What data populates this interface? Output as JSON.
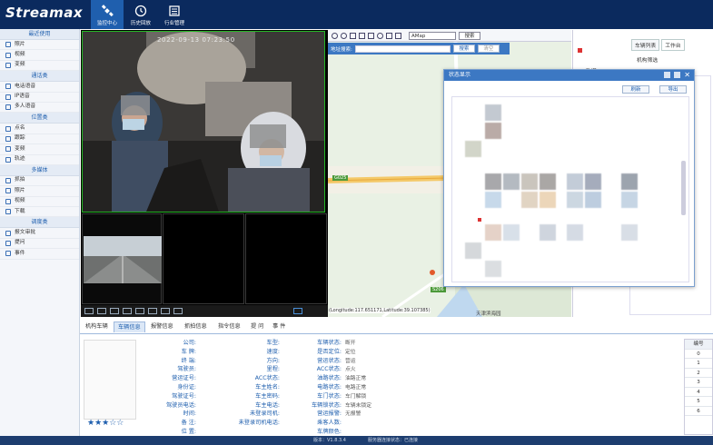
{
  "brand": {
    "logo_text": "Streamax"
  },
  "nav": [
    {
      "label": "监控中心",
      "icon": "satellite-icon",
      "active": true
    },
    {
      "label": "历史回放",
      "icon": "history-icon",
      "active": false
    },
    {
      "label": "行业管理",
      "icon": "management-icon",
      "active": false
    }
  ],
  "sidebar": {
    "sections": [
      {
        "title": "最近使用",
        "items": [
          "照片",
          "视频",
          "变频"
        ]
      },
      {
        "title": "通话类",
        "items": [
          "电话语音",
          "IP语音",
          "多人语音"
        ]
      },
      {
        "title": "位置类",
        "items": [
          "点名",
          "跟踪",
          "变频",
          "轨迹"
        ]
      },
      {
        "title": "多媒体",
        "items": [
          "抓拍",
          "照片",
          "视频",
          "下载"
        ]
      },
      {
        "title": "调度类",
        "items": [
          "报文审批",
          "提问",
          "事件"
        ]
      }
    ]
  },
  "video": {
    "timestamp": "2022-09-13 07:23:50"
  },
  "map": {
    "provider_select": "AMap",
    "search_button": "搜索",
    "address_label": "地址搜索:",
    "address_placeholder": "",
    "search2_button": "搜索",
    "clear_button": "清空",
    "road_g025": "G025",
    "road_s206": "S206",
    "place_label": "天津滨海园",
    "coords": "(Longitude:117.651171,Latitude:39.107385)"
  },
  "right_panel": {
    "tabs": [
      "车辆列表",
      "工作台"
    ],
    "row1": "机构筛选",
    "row2": "数据"
  },
  "dialog": {
    "title": "状态显示",
    "refresh": "刷新",
    "export": "导出"
  },
  "bottom_tabs": [
    "机构车辆",
    "车辆信息",
    "报警信息",
    "抓拍信息",
    "指令信息",
    "提 问",
    "事 件"
  ],
  "info": {
    "col1": [
      "公司:",
      "车 牌:",
      "终 端:",
      "驾驶员:",
      "营运证号:",
      "身份证:",
      "驾驶证号:",
      "驾驶员电话:",
      "时间:",
      "备 注:",
      "位 置:"
    ],
    "col2": [
      "车型:",
      "速度:",
      "方向:",
      "里程:",
      "ACC状态:",
      "车主姓名:",
      "车主密码:",
      "车主电话:",
      "未登录司机:",
      "未登录司机电话:"
    ],
    "col3": [
      "车辆状态:",
      "是否定位:",
      "营运状态:",
      "ACC状态:",
      "油路状态:",
      "电路状态:",
      "车门状态:",
      "车辆锁状态:",
      "营运报警:",
      "乘客人数:",
      "车牌颜色:"
    ],
    "col3_values": [
      "断开",
      "定位",
      "营运",
      "点火",
      "油路正常",
      "电路正常",
      "车门解锁",
      "车辆未锁定",
      "无报警",
      "",
      ""
    ],
    "rating": "★★★☆☆"
  },
  "id_table": {
    "header": "编号",
    "rows": [
      "0",
      "1",
      "2",
      "3",
      "4",
      "5",
      "6"
    ]
  },
  "statusbar": {
    "version": "版本：V1.8.3.4",
    "conn": "服务器连接状态：已连接"
  }
}
